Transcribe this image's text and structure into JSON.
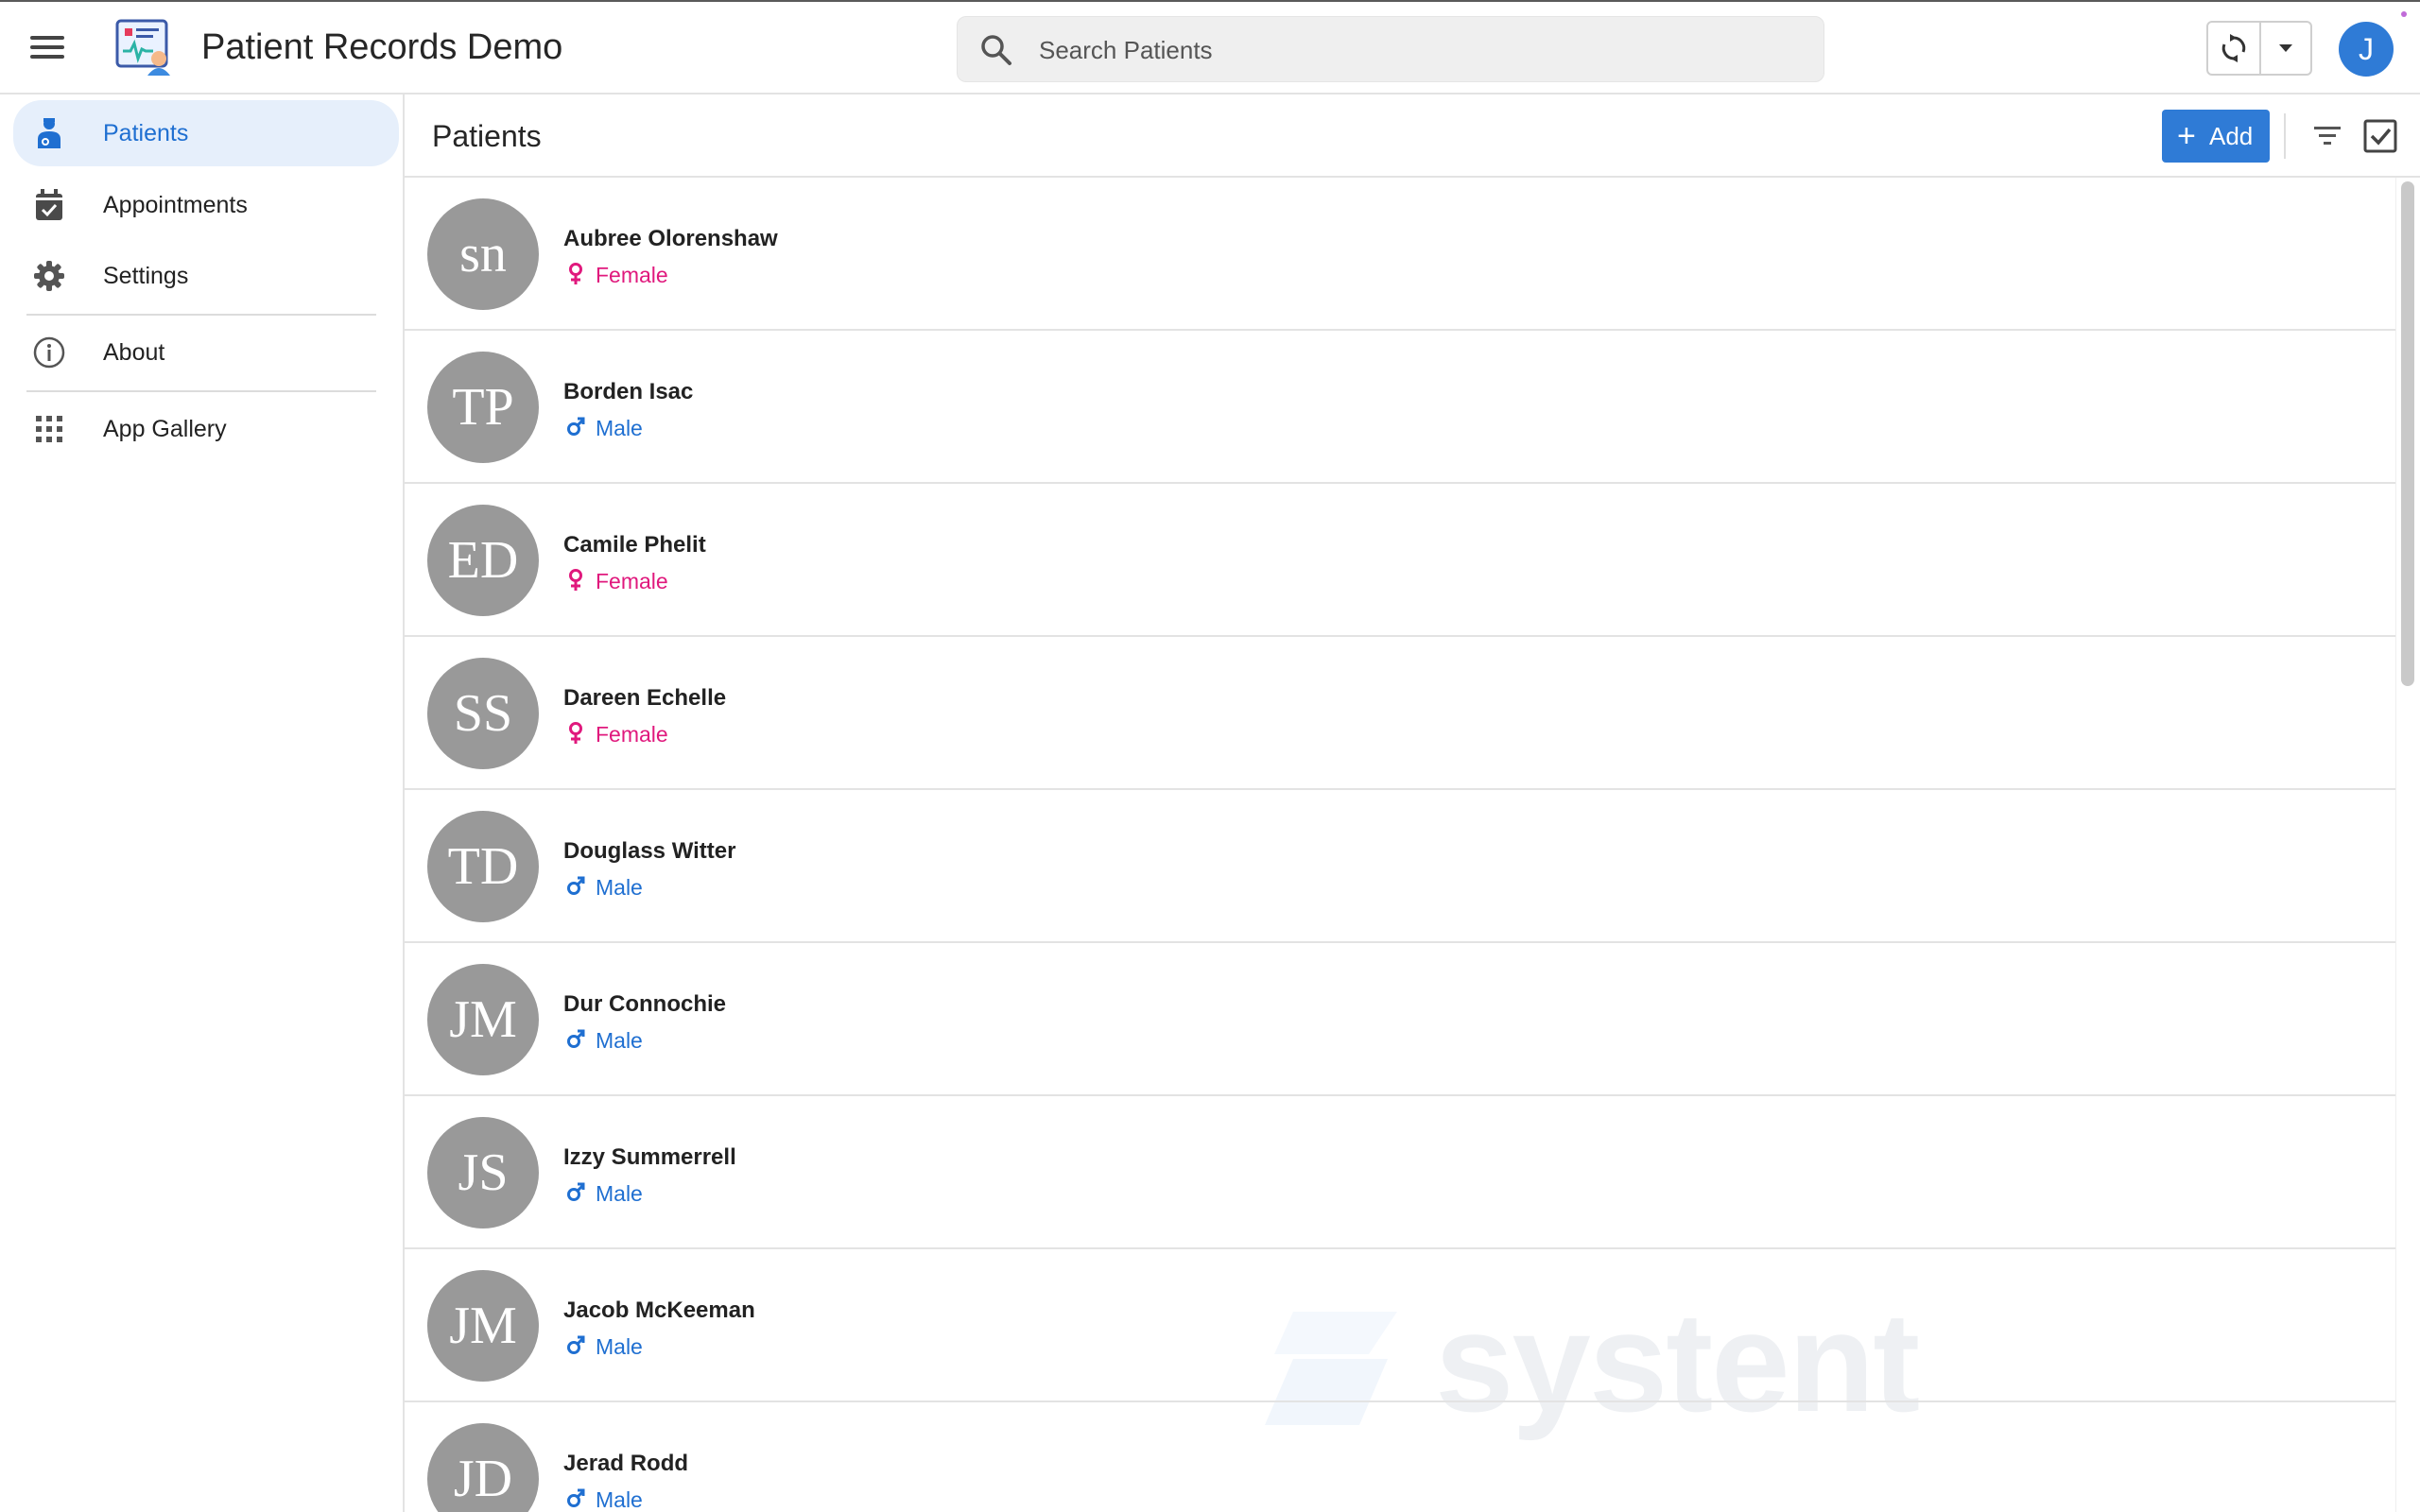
{
  "app": {
    "title": "Patient Records Demo",
    "user_initial": "J",
    "accent_color": "#2f7bd6"
  },
  "search": {
    "placeholder": "Search Patients",
    "value": ""
  },
  "sidebar": {
    "items": [
      {
        "label": "Patients",
        "icon": "patient-icon",
        "active": true
      },
      {
        "label": "Appointments",
        "icon": "calendar-check-icon",
        "active": false
      },
      {
        "label": "Settings",
        "icon": "gear-icon",
        "active": false
      },
      {
        "label": "About",
        "icon": "info-icon",
        "active": false
      },
      {
        "label": "App Gallery",
        "icon": "grid-icon",
        "active": false
      }
    ]
  },
  "main": {
    "title": "Patients",
    "add_label": "Add",
    "patients": [
      {
        "initials": "sn",
        "name": "Aubree Olorenshaw",
        "gender": "Female"
      },
      {
        "initials": "TP",
        "name": "Borden Isac",
        "gender": "Male"
      },
      {
        "initials": "ED",
        "name": "Camile Phelit",
        "gender": "Female"
      },
      {
        "initials": "SS",
        "name": "Dareen Echelle",
        "gender": "Female"
      },
      {
        "initials": "TD",
        "name": "Douglass Witter",
        "gender": "Male"
      },
      {
        "initials": "JM",
        "name": "Dur Connochie",
        "gender": "Male"
      },
      {
        "initials": "JS",
        "name": "Izzy Summerrell",
        "gender": "Male"
      },
      {
        "initials": "JM",
        "name": "Jacob McKeeman",
        "gender": "Male"
      },
      {
        "initials": "JD",
        "name": "Jerad Rodd",
        "gender": "Male"
      }
    ]
  },
  "watermark": {
    "text": "systent"
  },
  "colors": {
    "female": "#e0197d",
    "male": "#1f6fd1",
    "avatar_bg": "#999999"
  }
}
